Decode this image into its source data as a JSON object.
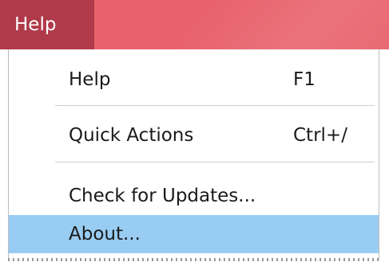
{
  "menubar": {
    "active_menu": "Help",
    "background_color": "#e8626c",
    "active_color": "#b03a4a"
  },
  "dropdown": {
    "items": [
      {
        "label": "Help",
        "shortcut": "F1"
      },
      {
        "label": "Quick Actions",
        "shortcut": "Ctrl+/"
      },
      {
        "label": "Check for Updates...",
        "shortcut": ""
      },
      {
        "label": "About...",
        "shortcut": "",
        "highlighted": true
      }
    ],
    "highlight_color": "#99ccf3"
  }
}
